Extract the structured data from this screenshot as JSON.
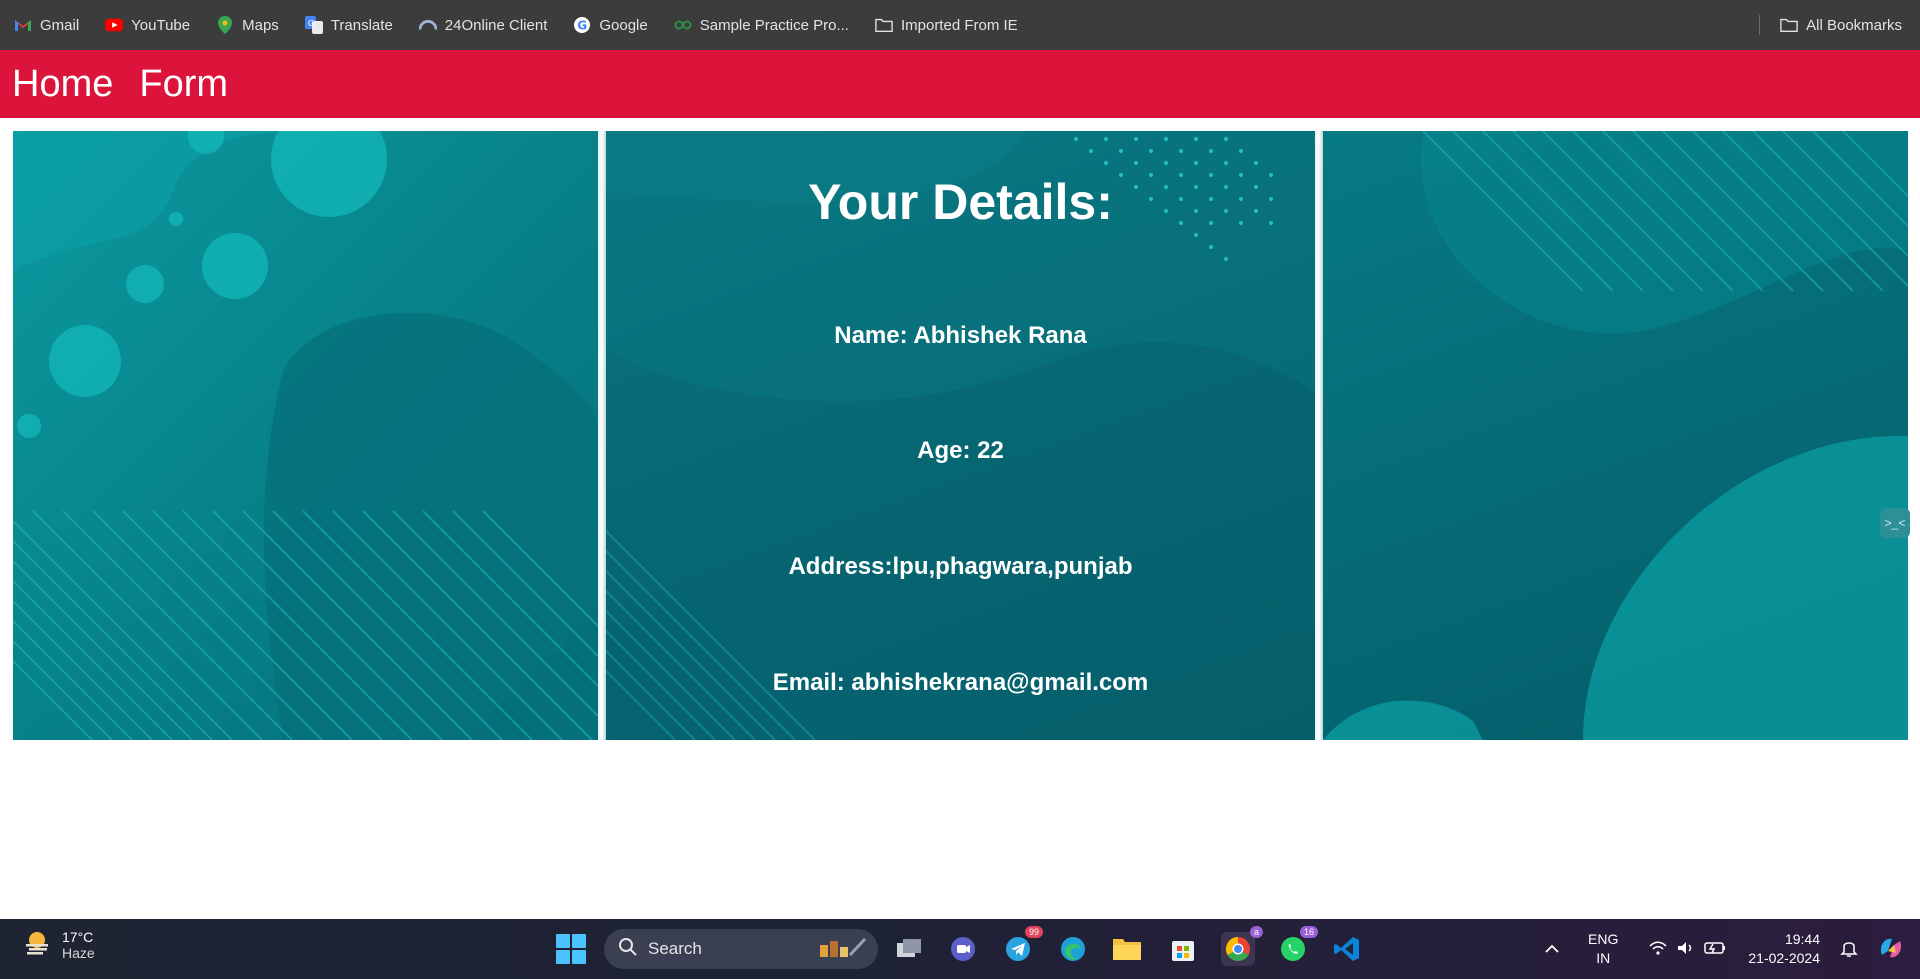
{
  "bookmarks": {
    "items": [
      {
        "label": "Gmail",
        "icon": "gmail-icon"
      },
      {
        "label": "YouTube",
        "icon": "youtube-icon"
      },
      {
        "label": "Maps",
        "icon": "maps-icon"
      },
      {
        "label": "Translate",
        "icon": "translate-icon"
      },
      {
        "label": "24Online Client",
        "icon": "24online-icon"
      },
      {
        "label": "Google",
        "icon": "google-icon"
      },
      {
        "label": "Sample Practice Pro...",
        "icon": "gfg-icon"
      },
      {
        "label": "Imported From IE",
        "icon": "folder-icon"
      }
    ],
    "all_bookmarks": "All Bookmarks"
  },
  "navbar": {
    "home": "Home",
    "form": "Form",
    "background": "#dc143c"
  },
  "details": {
    "title": "Your Details:",
    "name": "Name: Abhishek Rana",
    "age": "Age: 22",
    "address": "Address:lpu,phagwara,punjab",
    "email": "Email: abhishekrana@gmail.com"
  },
  "taskbar": {
    "weather_temp": "17°C",
    "weather_cond": "Haze",
    "search_placeholder": "Search",
    "telegram_badge": "99",
    "chrome_badge": "a",
    "whatsapp_badge": "16",
    "lang_top": "ENG",
    "lang_bottom": "IN",
    "time": "19:44",
    "date": "21-02-2024"
  }
}
